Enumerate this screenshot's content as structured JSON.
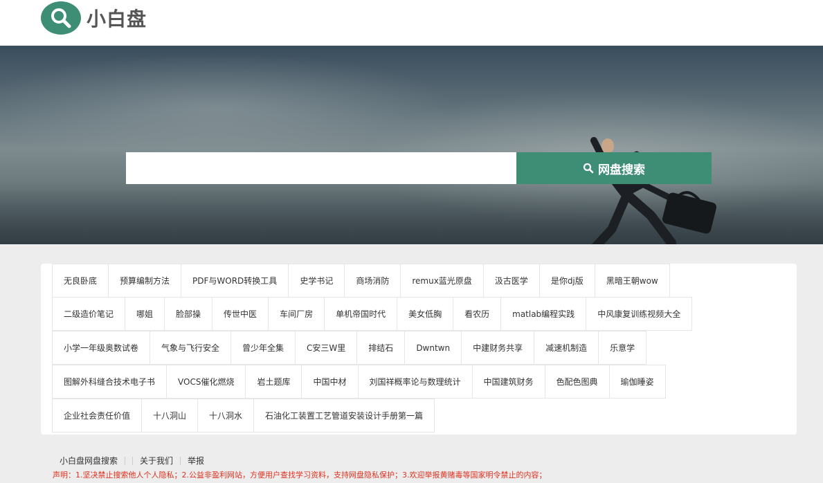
{
  "site": {
    "name": "小白盘"
  },
  "search": {
    "placeholder": "",
    "button_label": "网盘搜索"
  },
  "tag_rows": [
    [
      "无良卧底",
      "预算编制方法",
      "PDF与WORD转换工具",
      "史学书记",
      "商场消防",
      "remux蓝光原盘",
      "汲古医学",
      "是你dj版",
      "黑暗王朝wow"
    ],
    [
      "二级造价笔记",
      "哪姐",
      "脸部操",
      "传世中医",
      "车间厂房",
      "单机帝国时代",
      "美女低胸",
      "看农历",
      "matlab编程实践",
      "中风康复训练视频大全"
    ],
    [
      "小学一年级奥数试卷",
      "气象与飞行安全",
      "曾少年全集",
      "C安三W里",
      "排结石",
      "Dwntwn",
      "中建财务共享",
      "减速机制造",
      "乐意学"
    ],
    [
      "图解外科缝合技术电子书",
      "VOCS催化燃烧",
      "岩土题库",
      "中国中材",
      "刘国祥概率论与数理统计",
      "中国建筑财务",
      "色配色图典",
      "瑜伽睡姿"
    ],
    [
      "企业社会责任价值",
      "十八洞山",
      "十八洞水",
      "石油化工装置工艺管道安装设计手册第一篇"
    ]
  ],
  "footer": {
    "links": [
      "小白盘网盘搜索",
      "关于我们",
      "举报"
    ],
    "notice": "声明：1.坚决禁止搜索他人个人隐私；2.公益非盈利网站，方便用户查找学习资料，支持网盘隐私保护；3.欢迎举报黄赌毒等国家明令禁止的内容；"
  },
  "colors": {
    "accent": "#3e8e76",
    "notice": "#e0301e"
  }
}
